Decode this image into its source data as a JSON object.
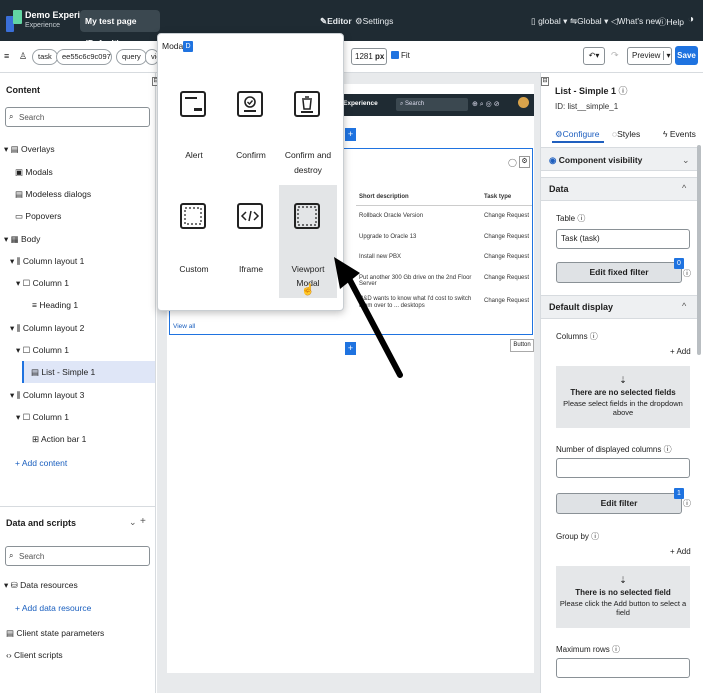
{
  "topbar": {
    "app_name": "Demo Experience",
    "app_subtitle": "Experience",
    "page_selector": "My test page (Default)",
    "editor_label": "Editor",
    "settings_label": "Settings",
    "scope_label": "global",
    "language_label": "Global",
    "whats_new_label": "What's new",
    "help_label": "Help"
  },
  "toolbar": {
    "pill_task": "task",
    "pill_sysid": "ee55c6c9c09702...",
    "pill_query": "query",
    "pill_view": "view",
    "width_value": "1281",
    "width_unit": "px",
    "fit_label": "Fit",
    "preview_label": "Preview",
    "save_label": "Save"
  },
  "sidebar": {
    "content_title": "Content",
    "search_placeholder": "Search",
    "tree": [
      {
        "label": "Overlays"
      },
      {
        "label": "Modals"
      },
      {
        "label": "Modeless dialogs"
      },
      {
        "label": "Popovers"
      },
      {
        "label": "Body"
      },
      {
        "label": "Column layout 1"
      },
      {
        "label": "Column 1"
      },
      {
        "label": "Heading 1"
      },
      {
        "label": "Column layout 2"
      },
      {
        "label": "Column 1"
      },
      {
        "label": "List - Simple 1"
      },
      {
        "label": "Column layout 3"
      },
      {
        "label": "Column 1"
      },
      {
        "label": "Action bar 1"
      }
    ],
    "add_content": "+ Add content",
    "data_scripts_title": "Data and scripts",
    "data_search_placeholder": "Search",
    "data_resources": "Data resources",
    "add_data_resource": "+ Add data resource",
    "client_state": "Client state parameters",
    "client_scripts": "Client scripts"
  },
  "modal_popup": {
    "title": "Modal",
    "badge": "D",
    "tiles": [
      {
        "label": "Alert",
        "icon": "alert-modal-icon"
      },
      {
        "label": "Confirm",
        "icon": "confirm-modal-icon"
      },
      {
        "label": "Confirm and destroy",
        "icon": "trash-modal-icon"
      },
      {
        "label": "Custom",
        "icon": "custom-modal-icon"
      },
      {
        "label": "Iframe",
        "icon": "code-modal-icon"
      },
      {
        "label": "Viewport Modal",
        "icon": "viewport-modal-icon"
      }
    ]
  },
  "preview": {
    "experience_label": "Experience",
    "search_label": "Search",
    "columns": [
      "Short description",
      "Task type"
    ],
    "rows": [
      [
        "Rollback Oracle Version",
        "Change Request"
      ],
      [
        "Upgrade to Oracle 13",
        "Change Request"
      ],
      [
        "Install new PBX",
        "Change Request"
      ],
      [
        "Put another 300 Gb drive on the 2nd Floor Server",
        "Change Request"
      ],
      [
        "R&D wants to know what I'd cost to switch them over to ... desktops",
        "Change Request"
      ]
    ],
    "view_all": "View all",
    "button_label": "Button"
  },
  "rightpanel": {
    "component_title": "List - Simple 1",
    "component_id": "ID: list__simple_1",
    "tab_configure": "Configure",
    "tab_styles": "Styles",
    "tab_events": "Events",
    "visibility_label": "Component visibility",
    "data_section": "Data",
    "table_label": "Table",
    "table_value": "Task (task)",
    "fixed_filter_btn": "Edit fixed filter",
    "fixed_filter_count": "0",
    "default_display": "Default display",
    "columns_label": "Columns",
    "add_label": "+ Add",
    "no_fields_title": "There are no selected fields",
    "no_fields_text": "Please select fields in the dropdown above",
    "num_columns_label": "Number of displayed columns",
    "edit_filter_btn": "Edit filter",
    "edit_filter_count": "1",
    "group_by_label": "Group by",
    "group_add_label": "+ Add",
    "no_field_title": "There is no selected field",
    "no_field_text": "Please click the Add button to select a field",
    "max_rows_label": "Maximum rows"
  },
  "colors": {
    "topbar": "#1f2b33",
    "accent": "#1f73e0",
    "selected": "#dfe6f7",
    "arrow": "#000000"
  }
}
